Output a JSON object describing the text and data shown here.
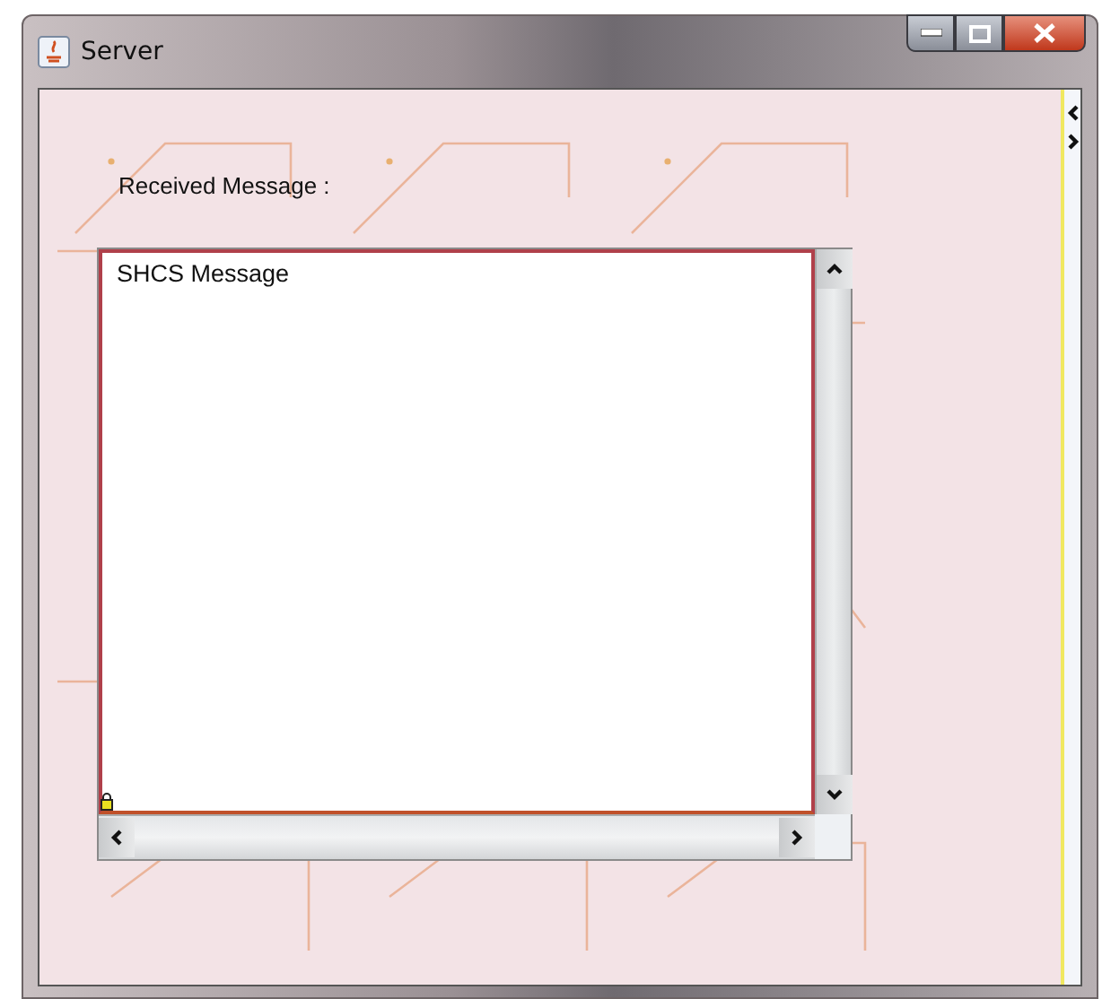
{
  "window": {
    "title": "Server"
  },
  "label": "Received Message :",
  "message_area": {
    "value": "SHCS Message"
  }
}
